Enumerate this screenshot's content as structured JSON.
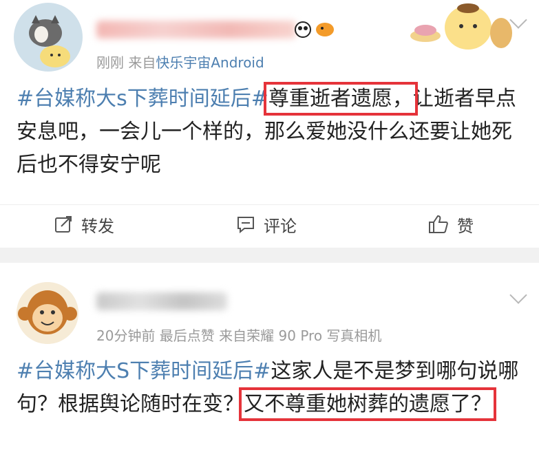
{
  "posts": [
    {
      "meta_time": "刚刚",
      "meta_from": "来自",
      "meta_source": "快乐宇宙Android",
      "topic": "#台媒称大s下葬时间延后#",
      "highlight1": "尊重逝者遗愿，",
      "rest": "让逝者早点安息吧，一会儿一个样的，那么爱她没什么还要让她死后也不得安宁呢",
      "actions": {
        "repost": "转发",
        "comment": "评论",
        "like": "赞"
      }
    },
    {
      "meta": "20分钟前 最后点赞 来自荣耀 90 Pro 写真相机",
      "topic": "#台媒称大S下葬时间延后#",
      "text": "这家人是不是梦到哪句说哪句？根据舆论随时在变？",
      "highlight": "又不尊重她树葬的遗愿了？"
    }
  ],
  "colors": {
    "link": "#4d7fb0",
    "highlight_box": "#e5333a",
    "meta": "#9a9a9a"
  },
  "icons": [
    "repost-icon",
    "comment-icon",
    "like-icon",
    "chevron-down-icon"
  ]
}
